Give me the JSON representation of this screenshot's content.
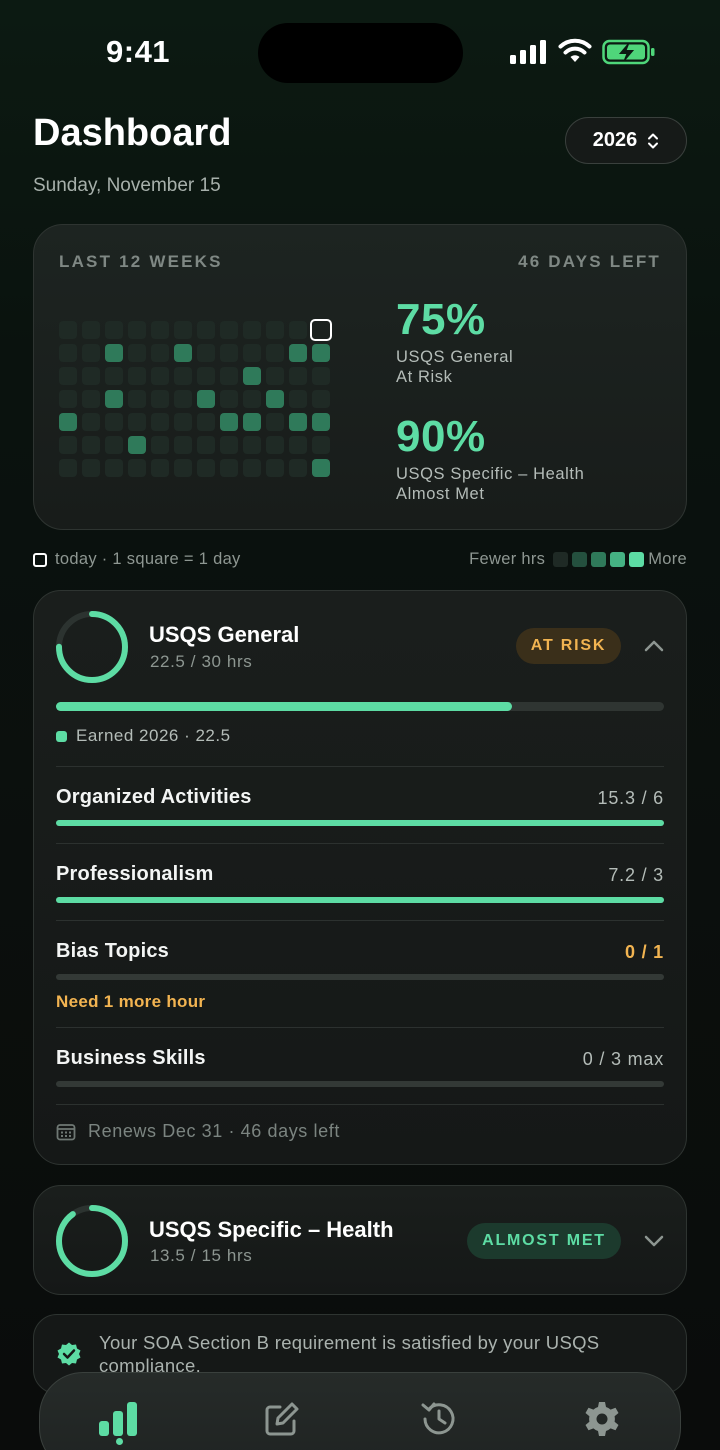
{
  "status_bar": {
    "time": "9:41"
  },
  "header": {
    "title": "Dashboard",
    "date": "Sunday, November 15",
    "year": "2026"
  },
  "heatmap": {
    "label_left": "LAST 12 WEEKS",
    "label_right": "46 DAYS LEFT",
    "levels_by_week": [
      [
        0,
        0,
        0,
        0,
        2,
        0,
        0
      ],
      [
        0,
        0,
        0,
        0,
        0,
        0,
        0
      ],
      [
        0,
        2,
        0,
        2,
        0,
        0,
        0
      ],
      [
        0,
        0,
        0,
        0,
        0,
        2,
        0
      ],
      [
        0,
        0,
        0,
        0,
        0,
        0,
        0
      ],
      [
        0,
        2,
        0,
        0,
        0,
        0,
        0
      ],
      [
        0,
        0,
        0,
        2,
        0,
        0,
        0
      ],
      [
        0,
        0,
        0,
        0,
        2,
        0,
        0
      ],
      [
        0,
        0,
        2,
        0,
        2,
        0,
        0
      ],
      [
        0,
        0,
        0,
        2,
        0,
        0,
        0
      ],
      [
        0,
        2,
        0,
        0,
        2,
        0,
        0
      ],
      [
        -1,
        2,
        0,
        0,
        2,
        0,
        2
      ]
    ],
    "today": {
      "week": 12,
      "day": 1
    },
    "stats": [
      {
        "percent": "75%",
        "name": "USQS General",
        "status": "At Risk"
      },
      {
        "percent": "90%",
        "name": "USQS Specific – Health",
        "status": "Almost Met"
      }
    ],
    "legend": {
      "today_text": "today · 1 square = 1 day",
      "fewer": "Fewer hrs",
      "more": "More",
      "colors": [
        "#1f2a25",
        "#24503e",
        "#2f7a5a",
        "#45b283",
        "#5ddca4"
      ]
    }
  },
  "general_card": {
    "title": "USQS General",
    "hours": "22.5 / 30 hrs",
    "progress": 0.75,
    "badge": "AT RISK",
    "earned": "Earned 2026 · 22.5",
    "categories": [
      {
        "name": "Organized Activities",
        "value": "15.3 / 6",
        "progress": 1.0
      },
      {
        "name": "Professionalism",
        "value": "7.2 / 3",
        "progress": 1.0
      },
      {
        "name": "Bias Topics",
        "value": "0 / 1",
        "progress": 0,
        "note": "Need 1 more hour"
      },
      {
        "name": "Business Skills",
        "value": "0 / 3 max",
        "progress": 0
      }
    ],
    "renews": "Renews Dec 31 · 46 days left"
  },
  "specific_card": {
    "title": "USQS Specific – Health",
    "hours": "13.5 / 15 hrs",
    "progress": 0.9,
    "badge": "ALMOST MET"
  },
  "soa_note": {
    "text": "Your SOA Section B requirement is satisfied by your USQS compliance."
  },
  "tabbar": {
    "icons": [
      "dashboard-icon",
      "log-entry-icon",
      "history-icon",
      "settings-icon"
    ],
    "active": 0
  },
  "colors": {
    "accent": "#5ddca4",
    "warning": "#f2b451",
    "badge_risk_bg": "#3a2f1a",
    "badge_met_bg": "#1c3a2d"
  }
}
